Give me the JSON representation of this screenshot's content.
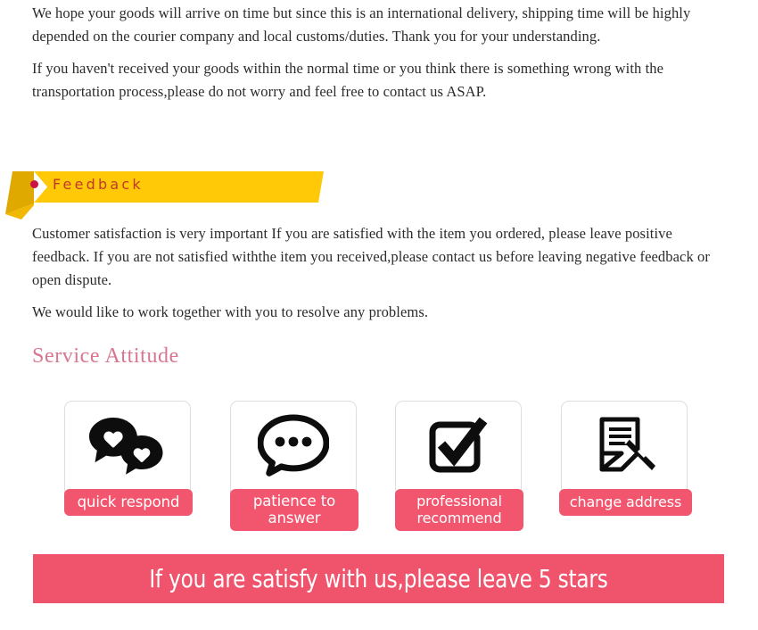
{
  "intro": {
    "paragraphs": [
      "We hope your goods will arrive on time but since this is an international delivery, shipping time will be highly depended on the courier company and local customs/duties. Thank you for your understanding.",
      "If you haven't received your goods within the normal time or you think there is something wrong with the transportation process,please do not worry and feel free to contact us ASAP."
    ]
  },
  "feedback_ribbon": {
    "title": "Feedback",
    "dot_icon": "bullet-dot-icon",
    "ribbon_color": "#FFC907",
    "ribbon_fold_color": "#E0A900",
    "title_color": "#C0392B"
  },
  "feedback": {
    "paragraphs": [
      "Customer satisfaction is very important If you are satisfied with the item you ordered, please leave positive feedback. If you are not satisfied withthe item you received,please contact us before leaving negative feedback or open dispute.",
      "We would like to work together with you to resolve any problems."
    ]
  },
  "service": {
    "heading": "Service Attitude",
    "heading_color": "#D9768F",
    "label_color": "#F1566E",
    "cards": [
      {
        "label": "quick respond",
        "icon": "chat-bubbles-heart-icon"
      },
      {
        "label": "patience to answer",
        "icon": "chat-bubble-dots-icon"
      },
      {
        "label": "professional recommend",
        "icon": "checkbox-check-icon"
      },
      {
        "label": "change address",
        "icon": "document-pen-icon"
      }
    ]
  },
  "bottom_banner": {
    "text": "If you are satisfy with us,please leave 5 stars",
    "background_color": "#F0546C",
    "text_color": "#FFFFFF"
  }
}
